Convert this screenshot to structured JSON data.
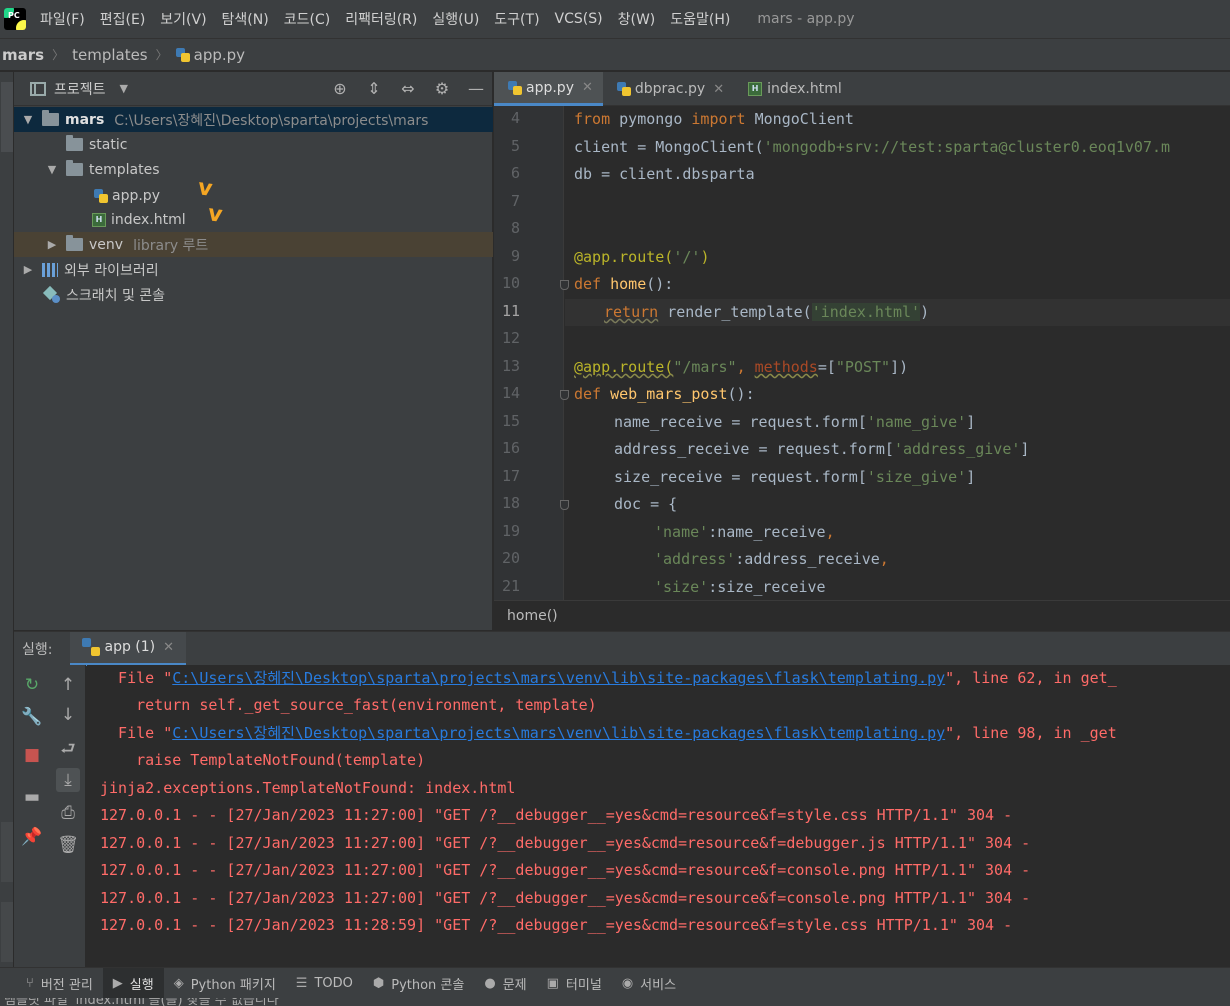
{
  "menubar": {
    "logo": "PC",
    "items": [
      "파일(F)",
      "편집(E)",
      "보기(V)",
      "탐색(N)",
      "코드(C)",
      "리팩터링(R)",
      "실행(U)",
      "도구(T)",
      "VCS(S)",
      "창(W)",
      "도움말(H)"
    ],
    "window_title": "mars - app.py"
  },
  "breadcrumb": {
    "root": "mars",
    "folder": "templates",
    "file": "app.py"
  },
  "project_panel": {
    "title": "프로젝트",
    "tree": [
      {
        "label": "mars",
        "hint": "C:\\Users\\장혜진\\Desktop\\sparta\\projects\\mars"
      },
      {
        "label": "static"
      },
      {
        "label": "templates"
      },
      {
        "label": "app.py"
      },
      {
        "label": "index.html"
      },
      {
        "label": "venv",
        "hint": "library 루트"
      },
      {
        "label": "외부 라이브러리"
      },
      {
        "label": "스크래치 및 콘솔"
      }
    ],
    "annotation_marks": [
      "v",
      "v"
    ]
  },
  "editor": {
    "tabs": [
      {
        "label": "app.py",
        "active": true
      },
      {
        "label": "dbprac.py",
        "active": false
      },
      {
        "label": "index.html",
        "active": false
      }
    ],
    "line_numbers": [
      "4",
      "5",
      "6",
      "7",
      "8",
      "9",
      "10",
      "11",
      "12",
      "13",
      "14",
      "15",
      "16",
      "17",
      "18",
      "19",
      "20",
      "21"
    ],
    "current_line": "11",
    "code": {
      "l4": {
        "kw1": "from",
        "mid": " pymongo ",
        "kw2": "import",
        "rest": " MongoClient"
      },
      "l5": {
        "pre": "client = MongoClient(",
        "str": "'mongodb+srv://test:sparta@cluster0.eoq1v07.m"
      },
      "l6": "db = client.dbsparta",
      "l9": {
        "dec": "@app.route(",
        "str": "'/'",
        "post": ")"
      },
      "l10": {
        "kw": "def",
        "fn": " home",
        "rest": "():"
      },
      "l11": {
        "kw": "return",
        "mid": " render_template(",
        "str": "'index.html'",
        "post": ")"
      },
      "l13": {
        "dec": "@app.route(",
        "str": "\"/mars\"",
        "comma": ", ",
        "param": "methods",
        "eq": "=[",
        "str2": "\"POST\"",
        "post": "])"
      },
      "l14": {
        "kw": "def",
        "fn": " web_mars_post",
        "rest": "():"
      },
      "l15": {
        "pre": "name_receive = request.form[",
        "str": "'name_give'",
        "post": "]"
      },
      "l16": {
        "pre": "address_receive = request.form[",
        "str": "'address_give'",
        "post": "]"
      },
      "l17": {
        "pre": "size_receive = request.form[",
        "str": "'size_give'",
        "post": "]"
      },
      "l18": "doc = {",
      "l19": {
        "str": "'name'",
        "rest": ":name_receive",
        "comma": ","
      },
      "l20": {
        "str": "'address'",
        "rest": ":address_receive",
        "comma": ","
      },
      "l21": {
        "str": "'size'",
        "rest": ":size_receive"
      }
    },
    "breadcrumb_function": "home()"
  },
  "run_panel": {
    "label": "실행:",
    "tab": "app (1)",
    "console": {
      "c1": {
        "pre": "  File \"",
        "link": "C:\\Users\\장혜진\\Desktop\\sparta\\projects\\mars\\venv\\lib\\site-packages\\flask\\templating.py",
        "post": "\", line 62, in get_"
      },
      "c2": "    return self._get_source_fast(environment, template)",
      "c3": {
        "pre": "  File \"",
        "link": "C:\\Users\\장혜진\\Desktop\\sparta\\projects\\mars\\venv\\lib\\site-packages\\flask\\templating.py",
        "post": "\", line 98, in _get"
      },
      "c4": "    raise TemplateNotFound(template)",
      "c5": "jinja2.exceptions.TemplateNotFound: index.html",
      "c6": "127.0.0.1 - - [27/Jan/2023 11:27:00] \"GET /?__debugger__=yes&cmd=resource&f=style.css HTTP/1.1\" 304 -",
      "c7": "127.0.0.1 - - [27/Jan/2023 11:27:00] \"GET /?__debugger__=yes&cmd=resource&f=debugger.js HTTP/1.1\" 304 -",
      "c8": "127.0.0.1 - - [27/Jan/2023 11:27:00] \"GET /?__debugger__=yes&cmd=resource&f=console.png HTTP/1.1\" 304 -",
      "c9": "127.0.0.1 - - [27/Jan/2023 11:27:00] \"GET /?__debugger__=yes&cmd=resource&f=console.png HTTP/1.1\" 304 -",
      "c10": "127.0.0.1 - - [27/Jan/2023 11:28:59] \"GET /?__debugger__=yes&cmd=resource&f=style.css HTTP/1.1\" 304 -"
    }
  },
  "bottom_bar": {
    "items": [
      "버전 관리",
      "실행",
      "Python 패키지",
      "TODO",
      "Python 콘솔",
      "문제",
      "터미널",
      "서비스"
    ]
  },
  "status_bar": {
    "message": "템플릿 파일 'index.html'을(를) 찾을 수 없습니다"
  },
  "colors": {
    "accent": "#4a88c7",
    "error_text": "#ff6b68",
    "link": "#287bde",
    "keyword": "#cc7832",
    "string": "#6a8759",
    "decorator": "#bbb529",
    "function": "#ffc66d",
    "annotation_mark": "#f5a623"
  }
}
